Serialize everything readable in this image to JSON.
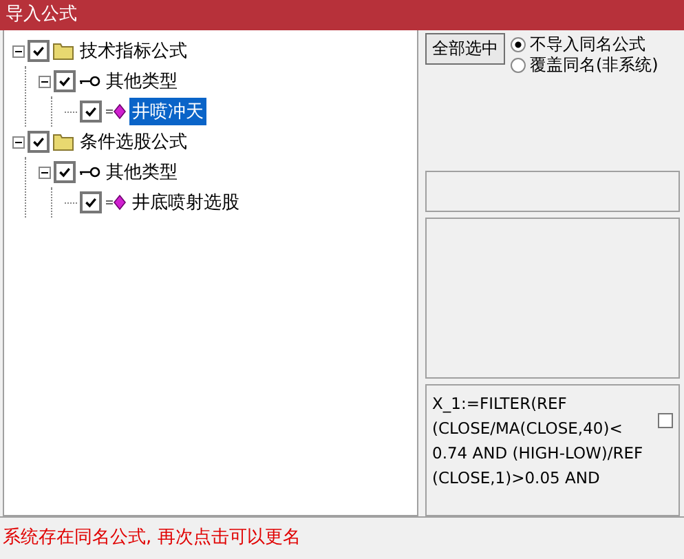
{
  "window": {
    "title": "导入公式"
  },
  "tree": [
    {
      "label": "技术指标公式",
      "kind": "folder",
      "checked": true,
      "expanded": true,
      "selected": false,
      "children": [
        {
          "label": "其他类型",
          "kind": "group",
          "checked": true,
          "expanded": true,
          "selected": false,
          "children": [
            {
              "label": "井喷冲天",
              "kind": "formula",
              "checked": true,
              "selected": true
            }
          ]
        }
      ]
    },
    {
      "label": "条件选股公式",
      "kind": "folder",
      "checked": true,
      "expanded": true,
      "selected": false,
      "children": [
        {
          "label": "其他类型",
          "kind": "group",
          "checked": true,
          "expanded": true,
          "selected": false,
          "children": [
            {
              "label": "井底喷射选股",
              "kind": "formula",
              "checked": true,
              "selected": false
            }
          ]
        }
      ]
    }
  ],
  "select_all_button": "全部选中",
  "radios": [
    {
      "label": "不导入同名公式",
      "selected": true
    },
    {
      "label": "覆盖同名(非系统)",
      "selected": false
    }
  ],
  "formula": {
    "text": "X_1:=FILTER(REF (CLOSE/MA(CLOSE,40)< 0.74 AND (HIGH-LOW)/REF (CLOSE,1)>0.05 AND",
    "checked": false
  },
  "status_bar": "系统存在同名公式, 再次点击可以更名"
}
